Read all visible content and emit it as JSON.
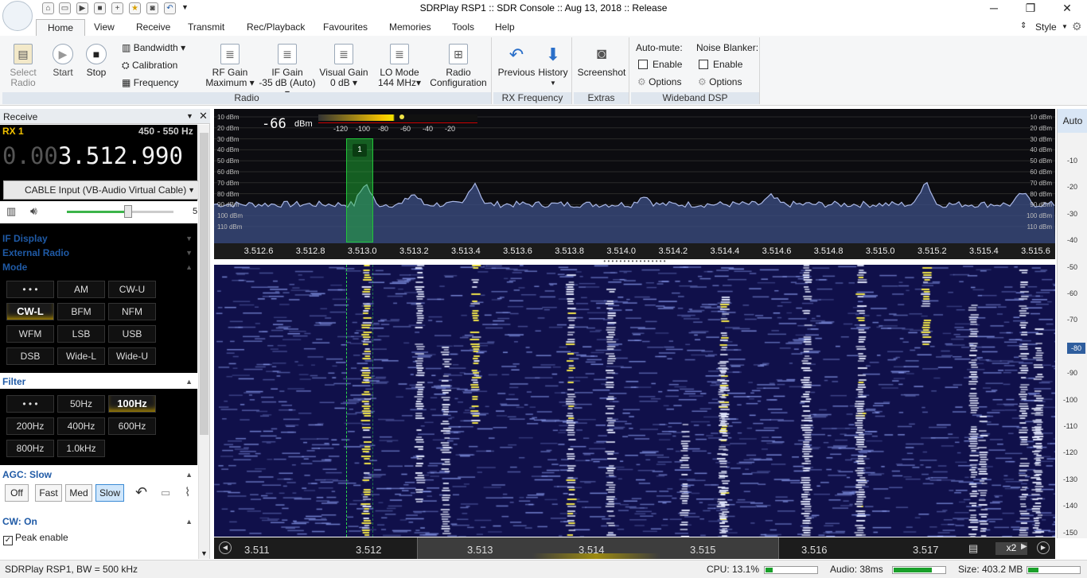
{
  "window": {
    "title": "SDRPlay RSP1 :: SDR Console :: Aug 13, 2018 :: Release",
    "style_label": "Style"
  },
  "tabs": [
    "Home",
    "View",
    "Receive",
    "Transmit",
    "Rec/Playback",
    "Favourites",
    "Memories",
    "Tools",
    "Help"
  ],
  "ribbon": {
    "select_radio": "Select\nRadio",
    "start": "Start",
    "stop": "Stop",
    "bandwidth": "Bandwidth",
    "calibration": "Calibration",
    "frequency": "Frequency",
    "rf_gain": "RF Gain",
    "rf_gain_val": "Maximum",
    "if_gain": "IF Gain",
    "if_gain_val": "-35 dB (Auto)",
    "visual_gain": "Visual Gain",
    "visual_gain_val": "0 dB",
    "lo_mode": "LO Mode",
    "lo_mode_val": "144 MHz",
    "radio_config_1": "Radio",
    "radio_config_2": "Configuration",
    "previous": "Previous",
    "history": "History",
    "screenshot": "Screenshot",
    "auto_mute": "Auto-mute:",
    "noise_blanker": "Noise Blanker:",
    "enable": "Enable",
    "options": "Options",
    "grp_radio": "Radio",
    "grp_rxfreq": "RX Frequency",
    "grp_extras": "Extras",
    "grp_wdsp": "Wideband DSP"
  },
  "receive": {
    "title": "Receive",
    "rx": "RX 1",
    "bw": "450 - 550 Hz",
    "freq_dim": "0.00",
    "freq": "3.512.990",
    "input": "CABLE Input (VB-Audio Virtual Cable)",
    "vol_val": "5",
    "sections": {
      "if_display": "IF Display",
      "external_radio": "External Radio",
      "mode": "Mode",
      "filter": "Filter",
      "agc": "AGC: Slow",
      "cw": "CW: On"
    },
    "modes": [
      "• • •",
      "AM",
      "CW-U",
      "CW-L",
      "BFM",
      "NFM",
      "WFM",
      "LSB",
      "USB",
      "DSB",
      "Wide-L",
      "Wide-U"
    ],
    "mode_selected": "CW-L",
    "filters": [
      "• • •",
      "50Hz",
      "100Hz",
      "200Hz",
      "400Hz",
      "600Hz",
      "800Hz",
      "1.0kHz"
    ],
    "filter_selected": "100Hz",
    "agc": [
      "Off",
      "Fast",
      "Med",
      "Slow"
    ],
    "agc_selected": "Slow",
    "peak_enable": "Peak enable"
  },
  "spectrum": {
    "level": "-66",
    "level_unit": "dBm",
    "meter_ticks": [
      "-120",
      "-100",
      "-80",
      "-60",
      "-40",
      "-20"
    ],
    "db_ticks": [
      "10 dBm",
      "20 dBm",
      "30 dBm",
      "40 dBm",
      "50 dBm",
      "60 dBm",
      "70 dBm",
      "80 dBm",
      "90 dBm",
      "100 dBm",
      "110 dBm"
    ],
    "marker": "1",
    "freq_ticks": [
      "3.512.6",
      "3.512.8",
      "3.513.0",
      "3.513.2",
      "3.513.4",
      "3.513.6",
      "3.513.8",
      "3.514.0",
      "3.514.2",
      "3.514.4",
      "3.514.6",
      "3.514.8",
      "3.515.0",
      "3.515.2",
      "3.515.4",
      "3.515.6"
    ]
  },
  "right_scale": {
    "auto": "Auto",
    "ticks": [
      "-10",
      "-20",
      "-30",
      "-40",
      "-50",
      "-60",
      "-70",
      "-80",
      "-90",
      "-100",
      "-110",
      "-120",
      "-130",
      "-140",
      "-150"
    ],
    "selected": "-80"
  },
  "bottom": {
    "labels": [
      "3.511",
      "3.512",
      "3.513",
      "3.514",
      "3.515",
      "3.516",
      "3.517"
    ],
    "zoom": "x2"
  },
  "status": {
    "left": "SDRPlay RSP1, BW = 500 kHz",
    "cpu": "CPU: 13.1%",
    "cpu_pct": 13.1,
    "audio": "Audio: 38ms",
    "audio_pct": 95,
    "size": "Size: 403.2 MB",
    "size_pct": 20
  },
  "colors": {
    "accent": "#1f5aa6",
    "marker": "#22c43a",
    "signal": "#f2e64a"
  }
}
